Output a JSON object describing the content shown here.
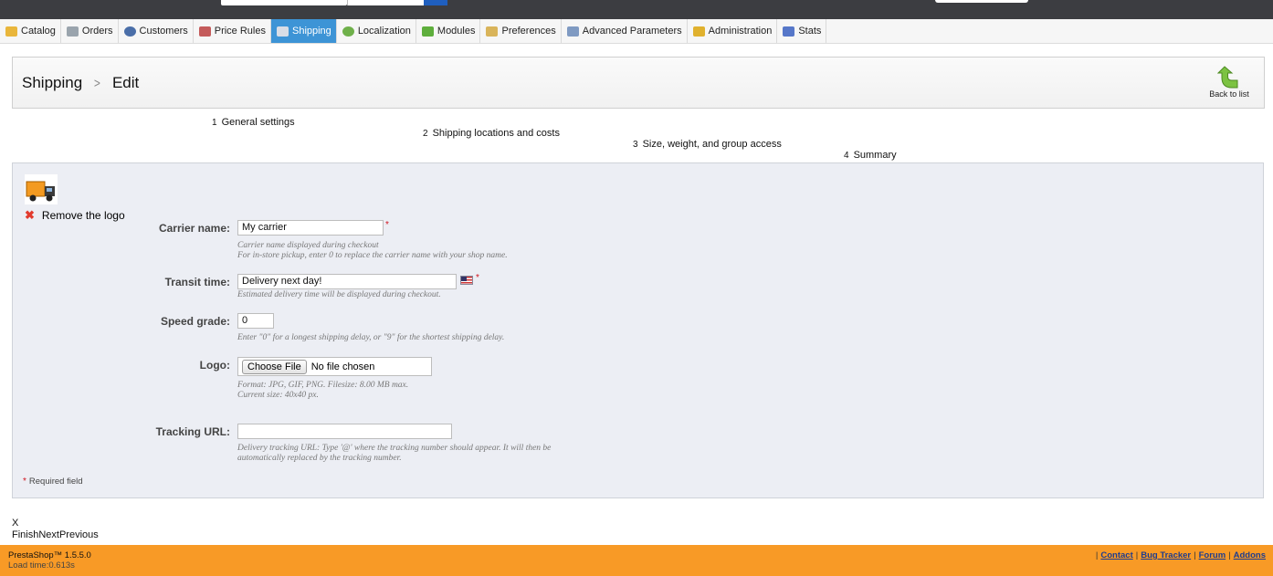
{
  "tabs": [
    {
      "label": "Catalog",
      "icon": "folder-icon",
      "color": "#e9b63b"
    },
    {
      "label": "Orders",
      "icon": "cart-icon",
      "color": "#9aa4ad"
    },
    {
      "label": "Customers",
      "icon": "user-icon",
      "color": "#4a6ea8"
    },
    {
      "label": "Price Rules",
      "icon": "price-tag-icon",
      "color": "#c45b5b"
    },
    {
      "label": "Shipping",
      "icon": "truck-icon",
      "color": "#d8dde6",
      "active": true
    },
    {
      "label": "Localization",
      "icon": "globe-icon",
      "color": "#6fb04a"
    },
    {
      "label": "Modules",
      "icon": "puzzle-icon",
      "color": "#5eae3c"
    },
    {
      "label": "Preferences",
      "icon": "preferences-icon",
      "color": "#d9b45a"
    },
    {
      "label": "Advanced Parameters",
      "icon": "wrench-icon",
      "color": "#7f9ac2"
    },
    {
      "label": "Administration",
      "icon": "key-icon",
      "color": "#e0b12e"
    },
    {
      "label": "Stats",
      "icon": "bar-chart-icon",
      "color": "#5677c9"
    }
  ],
  "breadcrumb": {
    "section": "Shipping",
    "sep": ">",
    "page": "Edit"
  },
  "back_label": "Back to list",
  "steps": [
    {
      "num": "1",
      "label": "General settings"
    },
    {
      "num": "2",
      "label": "Shipping locations and costs"
    },
    {
      "num": "3",
      "label": "Size, weight, and group access"
    },
    {
      "num": "4",
      "label": "Summary"
    }
  ],
  "remove_logo": "Remove the logo",
  "form": {
    "carrier_name": {
      "label": "Carrier name:",
      "value": "My carrier",
      "hint1": "Carrier name displayed during checkout",
      "hint2": "For in-store pickup, enter 0 to replace the carrier name with your shop name."
    },
    "transit_time": {
      "label": "Transit time:",
      "value": "Delivery next day!",
      "hint1": "Estimated delivery time will be displayed during checkout."
    },
    "speed_grade": {
      "label": "Speed grade:",
      "value": "0",
      "hint1": "Enter \"0\" for a longest shipping delay, or \"9\" for the shortest shipping delay."
    },
    "logo": {
      "label": "Logo:",
      "button": "Choose File",
      "file_text": "No file chosen",
      "hint1": "Format: JPG, GIF, PNG. Filesize: 8.00 MB max.",
      "hint2": "Current size: 40x40 px."
    },
    "tracking_url": {
      "label": "Tracking URL:",
      "value": "",
      "hint1": "Delivery tracking URL: Type '@' where the tracking number should appear. It will then be",
      "hint2": "automatically replaced by the tracking number."
    },
    "required_star": "*",
    "required_note": "Required field"
  },
  "wizard": {
    "close": "X",
    "buttons": "FinishNextPrevious"
  },
  "footer": {
    "version": "PrestaShop™ 1.5.5.0",
    "load_time": "Load time:0.613s",
    "sep": "|",
    "links": [
      "Contact",
      "Bug Tracker",
      "Forum",
      "Addons"
    ]
  }
}
